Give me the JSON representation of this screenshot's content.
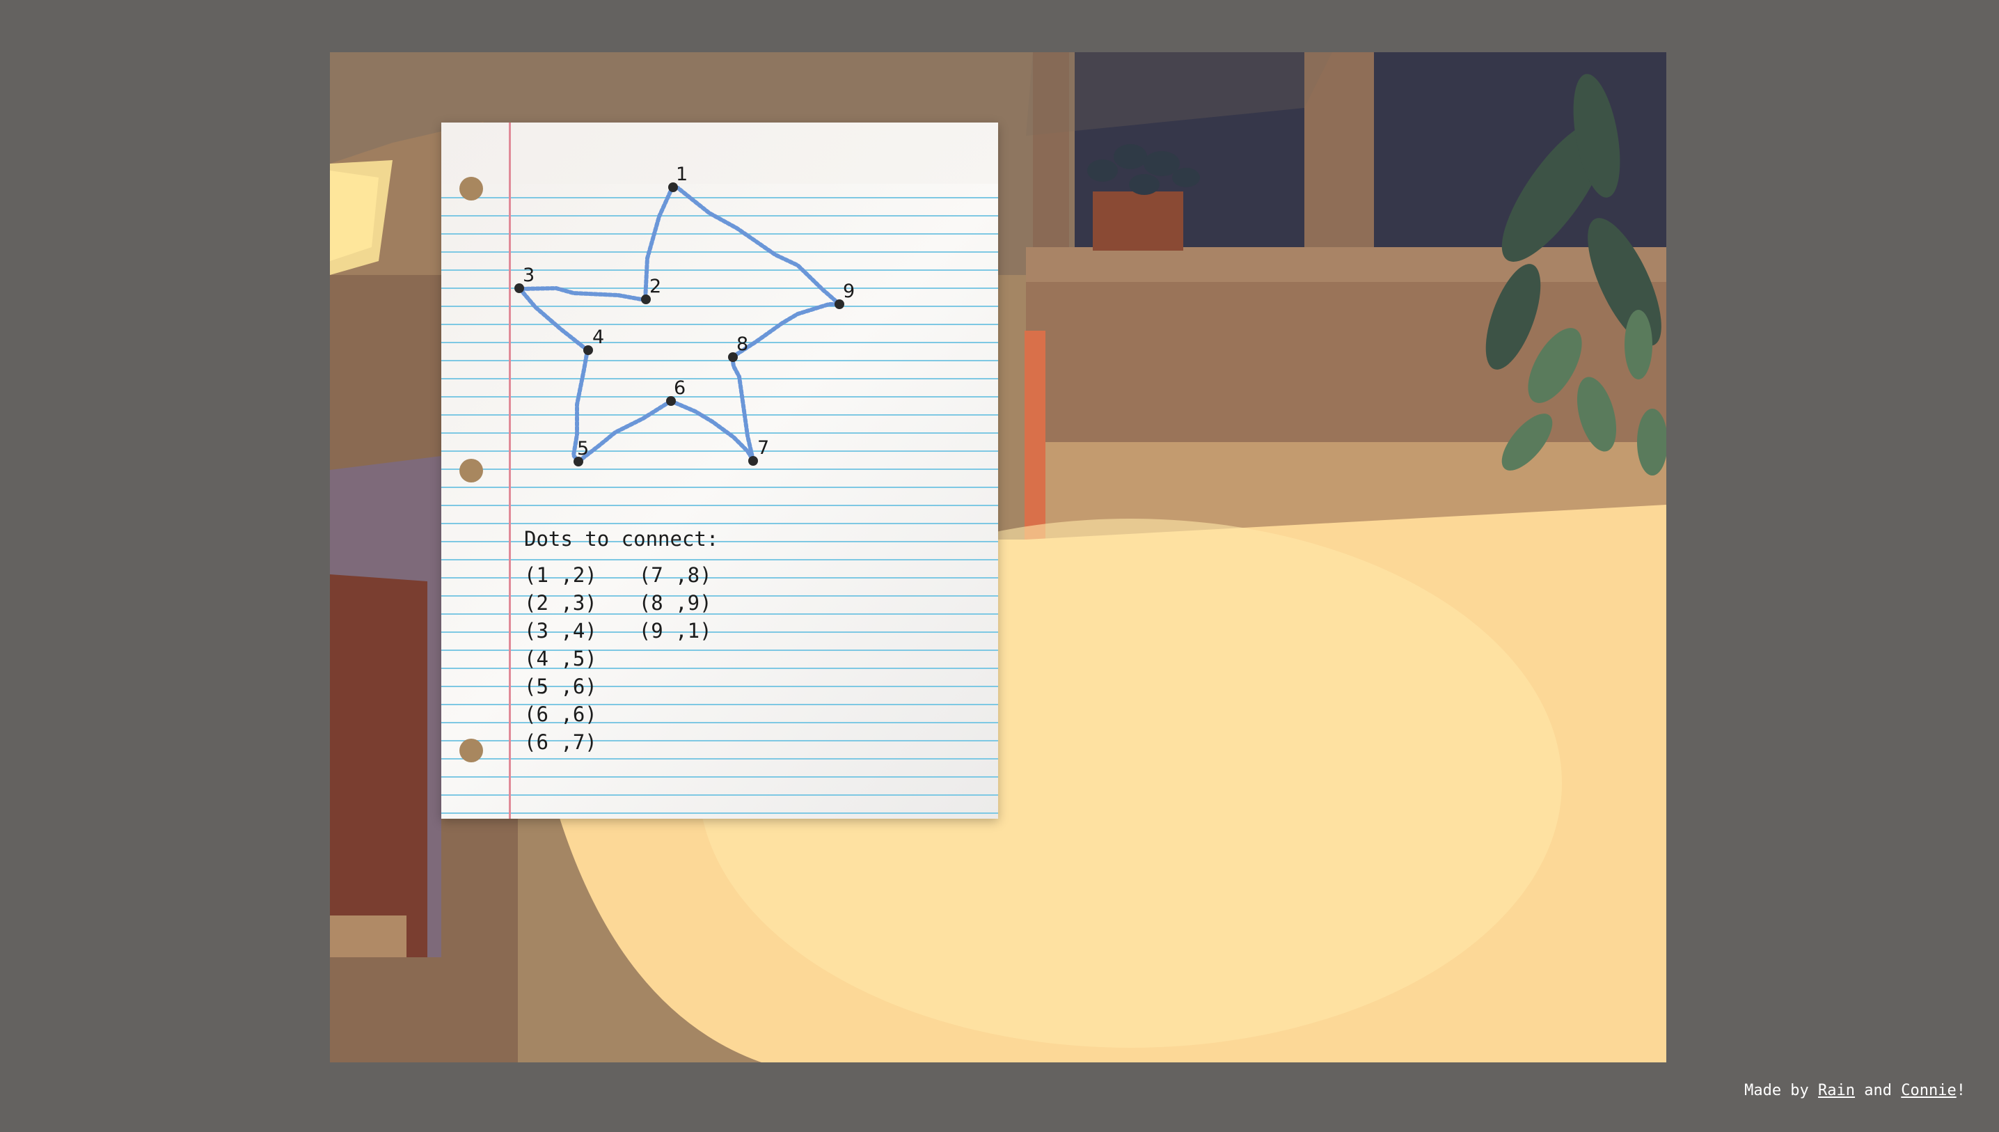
{
  "instructions": {
    "title": "Dots to connect:",
    "pairs_col1": [
      "(1 ,2)",
      "(2 ,3)",
      "(3 ,4)",
      "(4 ,5)",
      "(5 ,6)",
      "(6 ,6)",
      "(6 ,7)"
    ],
    "pairs_col2": [
      "(7 ,8)",
      "(8 ,9)",
      "(9 ,1)"
    ]
  },
  "dots": [
    {
      "label": "1"
    },
    {
      "label": "2"
    },
    {
      "label": "3"
    },
    {
      "label": "4"
    },
    {
      "label": "5"
    },
    {
      "label": "6"
    },
    {
      "label": "7"
    },
    {
      "label": "8"
    },
    {
      "label": "9"
    }
  ],
  "credit": {
    "prefix": "Made by ",
    "author1": "Rain",
    "middle": " and ",
    "author2": "Connie",
    "suffix": "!"
  },
  "colors": {
    "stroke": "#6a96d8",
    "dot": "#2a2a2a",
    "page_bg": "#646260"
  }
}
